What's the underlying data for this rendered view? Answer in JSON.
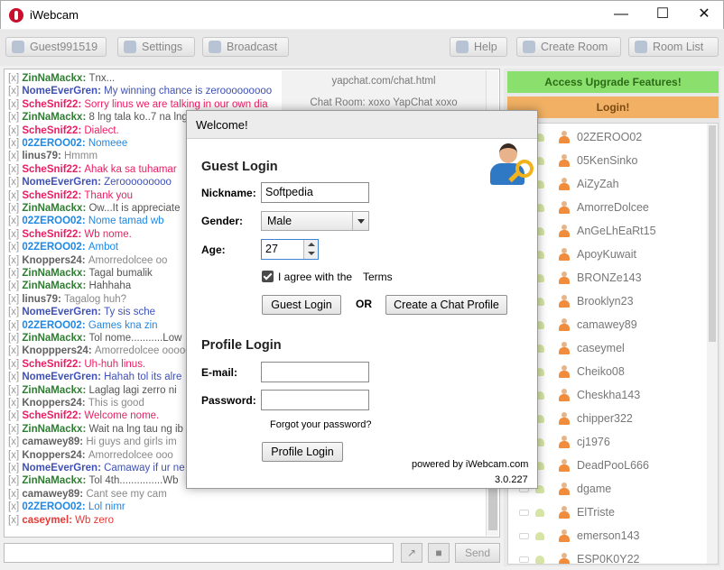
{
  "window": {
    "title": "iWebcam",
    "minimize": "—",
    "maximize": "☐",
    "close": "✕"
  },
  "toolbar": {
    "guest": "Guest991519",
    "settings": "Settings",
    "broadcast": "Broadcast",
    "help": "Help",
    "create_room": "Create Room",
    "room_list": "Room List"
  },
  "room_info": {
    "url": "yapchat.com/chat.html",
    "room": "Chat Room: xoxo YapChat xoxo"
  },
  "chat": {
    "lines": [
      {
        "user": "ZinNaMackx",
        "msg": "Tnx...",
        "ucolor": "#2e7d32",
        "mcolor": "#555"
      },
      {
        "user": "NomeEverGren",
        "msg": "My winning chance is zerooooooooo",
        "ucolor": "#3f51b5",
        "mcolor": "#3f51b5"
      },
      {
        "user": "ScheSnif22",
        "msg": "Sorry linus we are talking in our own dia",
        "ucolor": "#e91e63",
        "mcolor": "#e91e63"
      },
      {
        "user": "ZinNaMackx",
        "msg": "8 lng tala ko..7 na lng",
        "ucolor": "#2e7d32",
        "mcolor": "#555"
      },
      {
        "user": "ScheSnif22",
        "msg": "Dialect.",
        "ucolor": "#e91e63",
        "mcolor": "#e91e63"
      },
      {
        "user": "02ZEROO02",
        "msg": "Nomeee",
        "ucolor": "#1e88e5",
        "mcolor": "#1e88e5"
      },
      {
        "user": "linus79",
        "msg": "Hmmm",
        "ucolor": "#616161",
        "mcolor": "#888"
      },
      {
        "user": "ScheSnif22",
        "msg": "Ahak ka sa tuhamar",
        "ucolor": "#e91e63",
        "mcolor": "#e91e63"
      },
      {
        "user": "NomeEverGren",
        "msg": "Zerooooooooo",
        "ucolor": "#3f51b5",
        "mcolor": "#3f51b5"
      },
      {
        "user": "ScheSnif22",
        "msg": "Thank you",
        "ucolor": "#e91e63",
        "mcolor": "#e91e63"
      },
      {
        "user": "ZinNaMackx",
        "msg": "Ow...It is appreciate",
        "ucolor": "#2e7d32",
        "mcolor": "#555"
      },
      {
        "user": "02ZEROO02",
        "msg": "Nome tamad wb",
        "ucolor": "#1e88e5",
        "mcolor": "#1e88e5"
      },
      {
        "user": "ScheSnif22",
        "msg": "Wb nome.",
        "ucolor": "#e91e63",
        "mcolor": "#e91e63"
      },
      {
        "user": "02ZEROO02",
        "msg": "Ambot",
        "ucolor": "#1e88e5",
        "mcolor": "#1e88e5"
      },
      {
        "user": "Knoppers24",
        "msg": "Amorredolcee oo",
        "ucolor": "#616161",
        "mcolor": "#888"
      },
      {
        "user": "ZinNaMackx",
        "msg": "Tagal bumalik",
        "ucolor": "#2e7d32",
        "mcolor": "#555"
      },
      {
        "user": "ZinNaMackx",
        "msg": "Hahhaha",
        "ucolor": "#2e7d32",
        "mcolor": "#555"
      },
      {
        "user": "linus79",
        "msg": "Tagalog huh?",
        "ucolor": "#616161",
        "mcolor": "#888"
      },
      {
        "user": "NomeEverGren",
        "msg": "Ty sis sche",
        "ucolor": "#3f51b5",
        "mcolor": "#3f51b5"
      },
      {
        "user": "02ZEROO02",
        "msg": "Games kna zin",
        "ucolor": "#1e88e5",
        "mcolor": "#1e88e5"
      },
      {
        "user": "ZinNaMackx",
        "msg": "Tol nome...........Low",
        "ucolor": "#2e7d32",
        "mcolor": "#555"
      },
      {
        "user": "Knopppers24",
        "msg": "Amorredolcee ooooo",
        "ucolor": "#616161",
        "mcolor": "#888"
      },
      {
        "user": "ScheSnif22",
        "msg": "Uh-huh linus.",
        "ucolor": "#e91e63",
        "mcolor": "#e91e63"
      },
      {
        "user": "NomeEverGren",
        "msg": "Hahah tol its alre",
        "ucolor": "#3f51b5",
        "mcolor": "#3f51b5"
      },
      {
        "user": "ZinNaMackx",
        "msg": "Laglag lagi zerro ni",
        "ucolor": "#2e7d32",
        "mcolor": "#555"
      },
      {
        "user": "Knoppers24",
        "msg": "This is good",
        "ucolor": "#616161",
        "mcolor": "#888"
      },
      {
        "user": "ScheSnif22",
        "msg": "Welcome nome.",
        "ucolor": "#e91e63",
        "mcolor": "#e91e63"
      },
      {
        "user": "ZinNaMackx",
        "msg": "Wait na lng tau ng ib",
        "ucolor": "#2e7d32",
        "mcolor": "#555"
      },
      {
        "user": "camawey89",
        "msg": "Hi guys and girls im",
        "ucolor": "#616161",
        "mcolor": "#888"
      },
      {
        "user": "Knoppers24",
        "msg": "Amorredolcee ooo",
        "ucolor": "#616161",
        "mcolor": "#888"
      },
      {
        "user": "NomeEverGren",
        "msg": "Camaway if ur ne",
        "ucolor": "#3f51b5",
        "mcolor": "#3f51b5"
      },
      {
        "user": "ZinNaMackx",
        "msg": "Tol 4th...............Wb",
        "ucolor": "#2e7d32",
        "mcolor": "#555"
      },
      {
        "user": "camawey89",
        "msg": "Cant see my cam",
        "ucolor": "#616161",
        "mcolor": "#888"
      },
      {
        "user": "02ZEROO02",
        "msg": "Lol nimr",
        "ucolor": "#1e88e5",
        "mcolor": "#1e88e5"
      },
      {
        "user": "caseymel",
        "msg": "Wb zero",
        "ucolor": "#e53935",
        "mcolor": "#e53935"
      }
    ],
    "send": "Send",
    "send_placeholder": ""
  },
  "side": {
    "upgrade": "Access Upgrade Features!",
    "login": "Login!",
    "users": [
      "02ZEROO02",
      "05KenSinko",
      "AiZyZah",
      "AmorreDolcee",
      "AnGeLhEaRt15",
      "ApoyKuwait",
      "BRONZe143",
      "Brooklyn23",
      "camawey89",
      "caseymel",
      "Cheiko08",
      "Cheskha143",
      "chipper322",
      "cj1976",
      "DeadPooL666",
      "dgame",
      "ElTriste",
      "emerson143",
      "ESP0K0Y22"
    ]
  },
  "dialog": {
    "title": "Welcome!",
    "guest_heading": "Guest Login",
    "nickname_label": "Nickname:",
    "nickname_value": "Softpedia",
    "gender_label": "Gender:",
    "gender_value": "Male",
    "age_label": "Age:",
    "age_value": "27",
    "agree_label": "I agree with the",
    "terms_link": "Terms",
    "guest_login_btn": "Guest Login",
    "or": "OR",
    "create_profile_btn": "Create a Chat Profile",
    "profile_heading": "Profile Login",
    "email_label": "E-mail:",
    "email_value": "",
    "password_label": "Password:",
    "password_value": "",
    "forgot": "Forgot your password?",
    "profile_login_btn": "Profile Login",
    "powered": "powered by iWebcam.com",
    "version": "3.0.227"
  }
}
